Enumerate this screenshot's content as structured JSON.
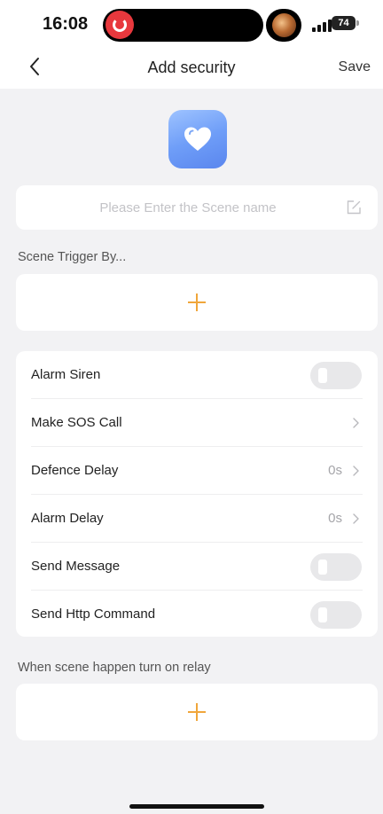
{
  "status_bar": {
    "time": "16:08",
    "battery": "74"
  },
  "nav": {
    "title": "Add security",
    "save_label": "Save",
    "back_icon": "chevron-left-icon"
  },
  "scene": {
    "icon": "heart-icon",
    "icon_color": "#6f9ef8",
    "name_placeholder": "Please Enter the Scene name",
    "name_value": ""
  },
  "trigger": {
    "label": "Scene Trigger By...",
    "add_icon": "plus-icon"
  },
  "settings": {
    "alarm_siren": {
      "label": "Alarm Siren",
      "enabled": false
    },
    "sos_call": {
      "label": "Make SOS Call"
    },
    "defence_delay": {
      "label": "Defence Delay",
      "value": "0s"
    },
    "alarm_delay": {
      "label": "Alarm Delay",
      "value": "0s"
    },
    "send_message": {
      "label": "Send Message",
      "enabled": false
    },
    "send_http": {
      "label": "Send Http Command",
      "enabled": false
    }
  },
  "relay": {
    "label": "When scene happen turn on relay",
    "add_icon": "plus-icon"
  },
  "colors": {
    "accent": "#f0a63b",
    "background": "#f2f2f4"
  }
}
